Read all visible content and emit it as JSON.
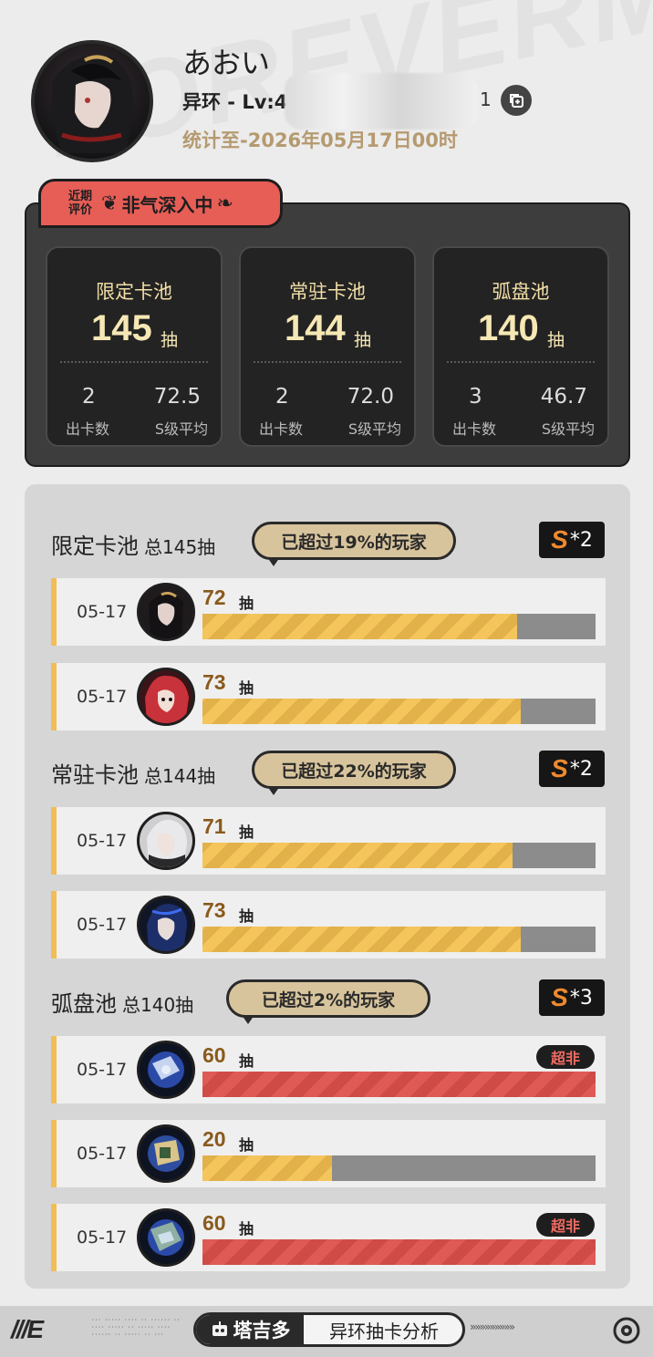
{
  "profile": {
    "name": "あおい",
    "uid_prefix": "异环 - Lv:4",
    "uid_suffix": "1",
    "stat_date": "统计至-2026年05月17日00时"
  },
  "rating": {
    "small_label": "近期评价",
    "text": "非气深入中"
  },
  "summary_cards": [
    {
      "title": "限定卡池",
      "count": "145",
      "unit": "抽",
      "cards": "2",
      "cards_label": "出卡数",
      "avg": "72.5",
      "avg_label": "S级平均"
    },
    {
      "title": "常驻卡池",
      "count": "144",
      "unit": "抽",
      "cards": "2",
      "cards_label": "出卡数",
      "avg": "72.0",
      "avg_label": "S级平均"
    },
    {
      "title": "弧盘池",
      "count": "140",
      "unit": "抽",
      "cards": "3",
      "cards_label": "出卡数",
      "avg": "46.7",
      "avg_label": "S级平均"
    }
  ],
  "sections": [
    {
      "title": "限定卡池",
      "total": "总145抽",
      "percentile": "已超过19%的玩家",
      "s_letter": "S",
      "s_count": "*2",
      "rows": [
        {
          "date": "05-17",
          "pulls": "72",
          "unit": "抽",
          "fill": 0.8,
          "bad": false
        },
        {
          "date": "05-17",
          "pulls": "73",
          "unit": "抽",
          "fill": 0.81,
          "bad": false
        }
      ]
    },
    {
      "title": "常驻卡池",
      "total": "总144抽",
      "percentile": "已超过22%的玩家",
      "s_letter": "S",
      "s_count": "*2",
      "rows": [
        {
          "date": "05-17",
          "pulls": "71",
          "unit": "抽",
          "fill": 0.79,
          "bad": false
        },
        {
          "date": "05-17",
          "pulls": "73",
          "unit": "抽",
          "fill": 0.81,
          "bad": false
        }
      ]
    },
    {
      "title": "弧盘池",
      "total": "总140抽",
      "percentile": "已超过2%的玩家",
      "s_letter": "S",
      "s_count": "*3",
      "rows": [
        {
          "date": "05-17",
          "pulls": "60",
          "unit": "抽",
          "fill": 1.0,
          "bad": true,
          "tag": "超非"
        },
        {
          "date": "05-17",
          "pulls": "20",
          "unit": "抽",
          "fill": 0.33,
          "bad": false
        },
        {
          "date": "05-17",
          "pulls": "60",
          "unit": "抽",
          "fill": 1.0,
          "bad": true,
          "tag": "超非"
        }
      ]
    }
  ],
  "footer": {
    "logo": "///E",
    "brand": "塔吉多",
    "caption": "异环抽卡分析"
  },
  "colors": {
    "bar_normal": "#f4c55a",
    "bar_bad": "#e05a55",
    "track": "#8c8c8c",
    "accent_gold": "#b59a70",
    "badge_red": "#e75e57"
  },
  "icons": [
    "copy-icon",
    "laurel-left-icon",
    "laurel-right-icon",
    "robot-icon",
    "eye-logo-icon"
  ]
}
